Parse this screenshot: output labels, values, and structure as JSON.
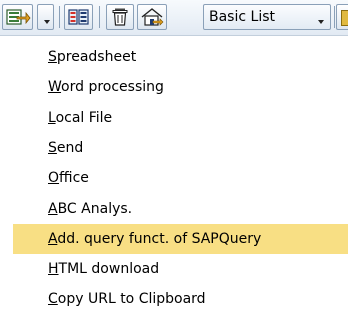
{
  "toolbar": {
    "buttons": [
      {
        "name": "export-button",
        "icon": "export-icon"
      },
      {
        "name": "layout-button",
        "icon": "layout-icon"
      },
      {
        "name": "delete-button",
        "icon": "trash-icon"
      },
      {
        "name": "save-layout-button",
        "icon": "house-icon"
      }
    ],
    "view_select": {
      "value": "Basic List"
    }
  },
  "menu": {
    "items": [
      {
        "label": "Spreadsheet",
        "mnemonic": "S",
        "rest": "preadsheet",
        "highlighted": false
      },
      {
        "label": "Word processing",
        "mnemonic": "W",
        "rest": "ord processing",
        "highlighted": false
      },
      {
        "label": "Local File",
        "mnemonic": "L",
        "rest": "ocal File",
        "highlighted": false
      },
      {
        "label": "Send",
        "mnemonic": "S",
        "rest": "end",
        "highlighted": false
      },
      {
        "label": "Office",
        "mnemonic": "O",
        "rest": "ffice",
        "highlighted": false
      },
      {
        "label": "ABC Analys.",
        "mnemonic": "A",
        "rest": "BC Analys.",
        "highlighted": false
      },
      {
        "label": "Add. query funct. of SAPQuery",
        "mnemonic": "A",
        "rest": "dd. query funct. of SAPQuery",
        "highlighted": true
      },
      {
        "label": "HTML download",
        "mnemonic": "H",
        "rest": "TML download",
        "highlighted": false
      },
      {
        "label": "Copy URL to Clipboard",
        "mnemonic": "C",
        "rest": "opy URL to Clipboard",
        "highlighted": false
      }
    ]
  },
  "colors": {
    "highlight": "#f8df84",
    "toolbar_border": "#8aa0b8"
  }
}
